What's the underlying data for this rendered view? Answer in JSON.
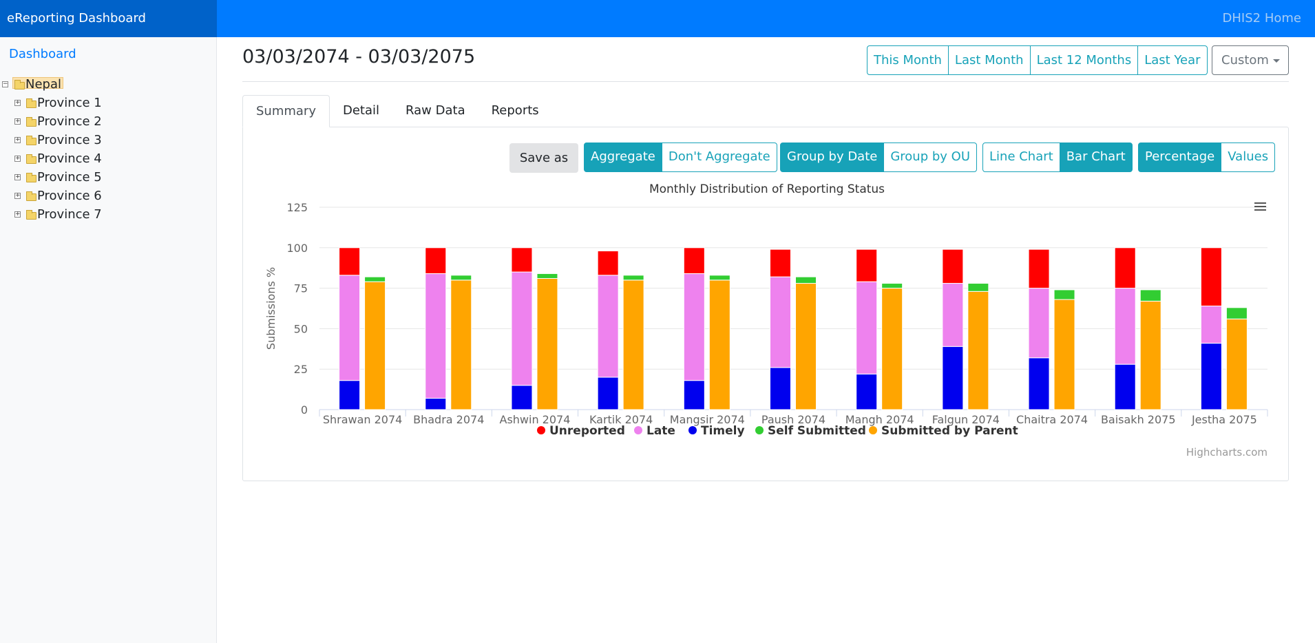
{
  "header": {
    "brand": "eReporting Dashboard",
    "home_link": "DHIS2 Home"
  },
  "sidebar": {
    "dashboard_link": "Dashboard",
    "tree": [
      {
        "label": "Nepal",
        "toggle": "⊟"
      },
      {
        "label": "Province 1",
        "toggle": "⊞"
      },
      {
        "label": "Province 2",
        "toggle": "⊞"
      },
      {
        "label": "Province 3",
        "toggle": "⊞"
      },
      {
        "label": "Province 4",
        "toggle": "⊞"
      },
      {
        "label": "Province 5",
        "toggle": "⊞"
      },
      {
        "label": "Province 6",
        "toggle": "⊞"
      },
      {
        "label": "Province 7",
        "toggle": "⊞"
      }
    ]
  },
  "main": {
    "date_range": "03/03/2074 - 03/03/2075",
    "period_buttons": [
      "This Month",
      "Last Month",
      "Last 12 Months",
      "Last Year"
    ],
    "custom_label": "Custom",
    "tabs": [
      "Summary",
      "Detail",
      "Raw Data",
      "Reports"
    ],
    "save_as": "Save as",
    "toggles": {
      "aggregate": [
        "Aggregate",
        "Don't Aggregate"
      ],
      "grouping": [
        "Group by Date",
        "Group by OU"
      ],
      "chart_type": [
        "Line Chart",
        "Bar Chart"
      ],
      "mode": [
        "Percentage",
        "Values"
      ]
    },
    "credits": "Highcharts.com"
  },
  "chart_data": {
    "type": "bar",
    "title": "Monthly Distribution of Reporting Status",
    "ylabel": "Submissions %",
    "ylim": [
      0,
      125
    ],
    "yticks": [
      0,
      25,
      50,
      75,
      100,
      125
    ],
    "grid": true,
    "legend_position": "bottom",
    "categories": [
      "Shrawan 2074",
      "Bhadra 2074",
      "Ashwin 2074",
      "Kartik 2074",
      "Mangsir 2074",
      "Paush 2074",
      "Mangh 2074",
      "Falgun 2074",
      "Chaitra 2074",
      "Baisakh 2075",
      "Jestha 2075"
    ],
    "stacks": [
      {
        "stack": "reporting",
        "series": [
          "Timely",
          "Late",
          "Unreported"
        ]
      },
      {
        "stack": "parent",
        "series": [
          "Submitted by Parent",
          "Self Submitted"
        ]
      }
    ],
    "series": [
      {
        "name": "Unreported",
        "color": "#ff0000",
        "values": [
          17,
          16,
          15,
          15,
          16,
          17,
          20,
          21,
          24,
          25,
          36
        ]
      },
      {
        "name": "Late",
        "color": "#ee82ee",
        "values": [
          65,
          77,
          70,
          63,
          66,
          56,
          57,
          39,
          43,
          47,
          23
        ]
      },
      {
        "name": "Timely",
        "color": "#0000ee",
        "values": [
          18,
          7,
          15,
          20,
          18,
          26,
          22,
          39,
          32,
          28,
          41
        ]
      },
      {
        "name": "Self Submitted",
        "color": "#32cd32",
        "values": [
          3,
          3,
          3,
          3,
          3,
          4,
          3,
          5,
          6,
          7,
          7
        ]
      },
      {
        "name": "Submitted by Parent",
        "color": "#ffa500",
        "values": [
          79,
          80,
          81,
          80,
          80,
          78,
          75,
          73,
          68,
          67,
          56
        ]
      }
    ],
    "legend": [
      "Unreported",
      "Late",
      "Timely",
      "Self Submitted",
      "Submitted by Parent"
    ]
  }
}
